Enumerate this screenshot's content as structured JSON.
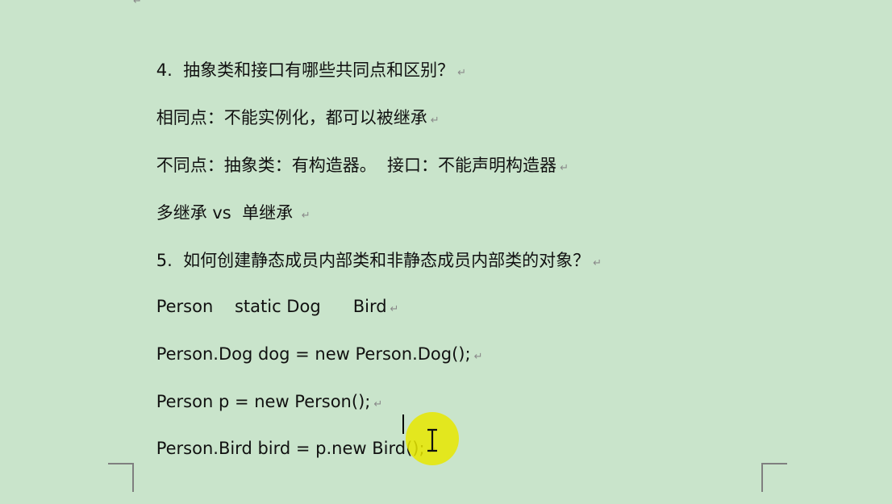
{
  "document": {
    "top_paragraph_mark": "↵",
    "lines": [
      {
        "text": "4.  抽象类和接口有哪些共同点和区别？",
        "mark": "↵"
      },
      {
        "text": "相同点：不能实例化，都可以被继承",
        "mark": "↵"
      },
      {
        "text": "不同点：抽象类：有构造器。  接口：不能声明构造器",
        "mark": "↵"
      },
      {
        "text": "多继承 vs  单继承 ",
        "mark": "↵"
      },
      {
        "text": "5.  如何创建静态成员内部类和非静态成员内部类的对象？",
        "mark": "↵"
      },
      {
        "text": "Person    static Dog      Bird",
        "mark": "↵"
      },
      {
        "text": "Person.Dog dog = new Person.Dog();",
        "mark": "↵"
      },
      {
        "text": "Person p = new Person();",
        "mark": "↵"
      },
      {
        "text": "Person.Bird bird = p.new Bird();",
        "mark": "↵"
      }
    ]
  },
  "colors": {
    "background": "#c9e4cb",
    "cursor_highlight": "#e7e700",
    "paragraph_mark": "#8a8a8a"
  },
  "cursor": {
    "icon": "text-cursor-icon"
  }
}
